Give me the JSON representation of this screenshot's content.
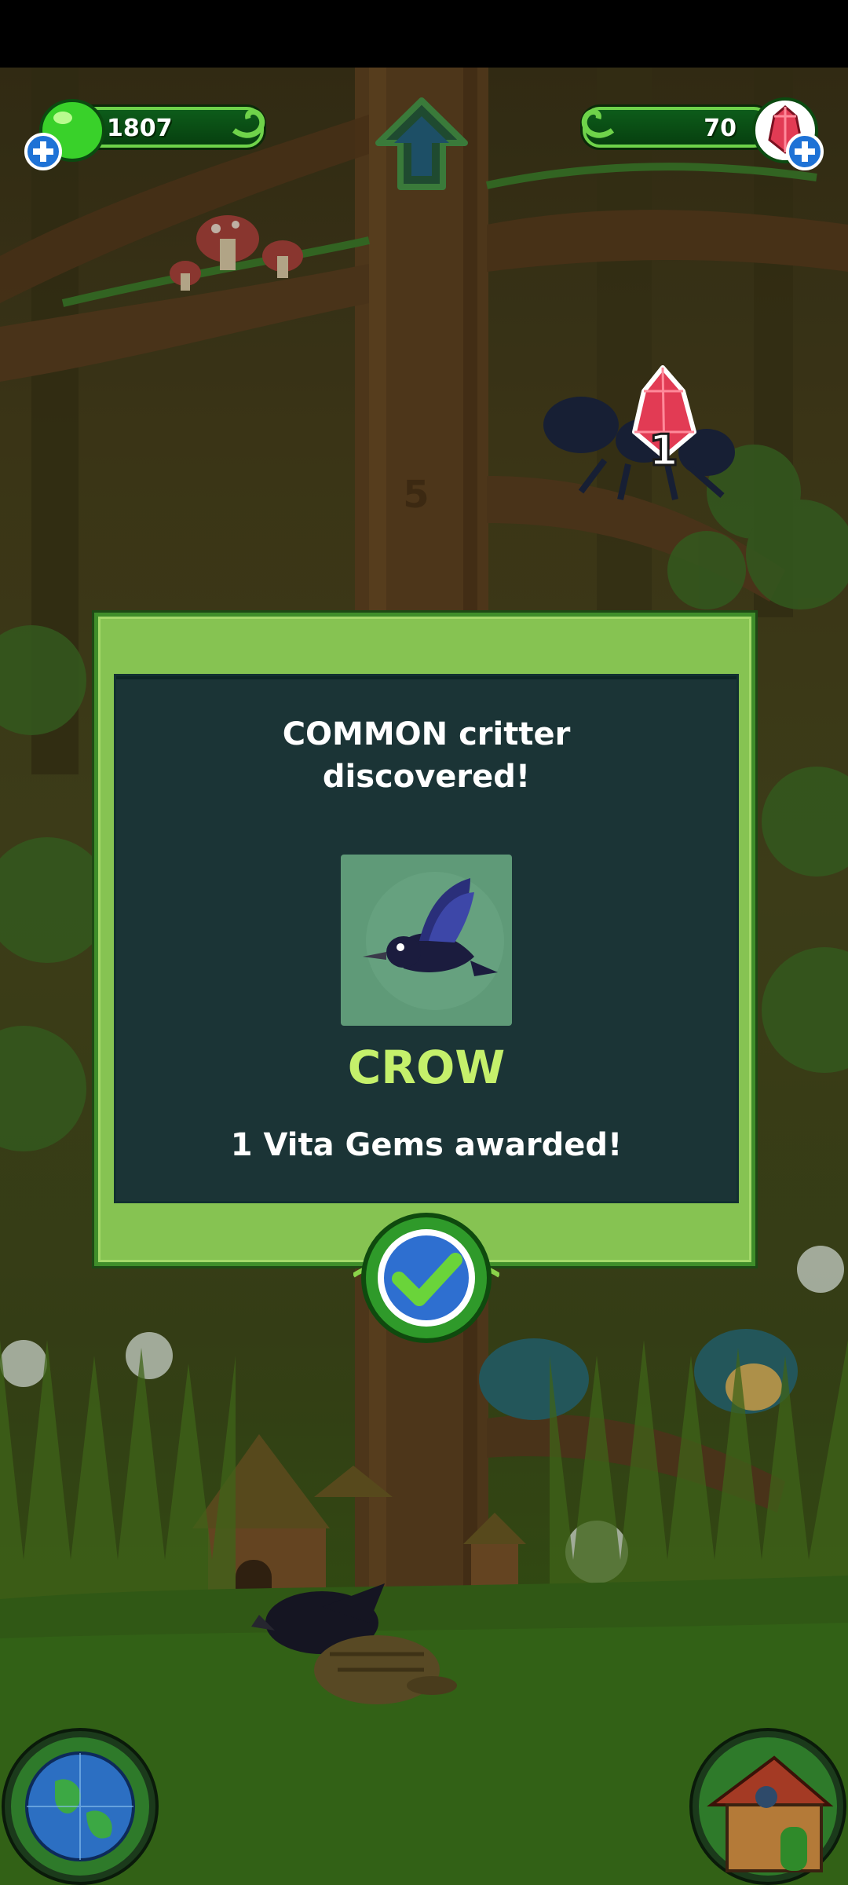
{
  "hud": {
    "vita_drops": {
      "value": "1807",
      "icon": "green-drop-icon",
      "add_icon": "plus-icon"
    },
    "vita_gems": {
      "value": "70",
      "icon": "red-gem-icon",
      "add_icon": "plus-icon"
    },
    "up_arrow_icon": "up-arrow-icon"
  },
  "scene": {
    "floating_gem": {
      "icon": "red-gem-icon",
      "count": "1"
    },
    "tree_level_number": "5"
  },
  "dialog": {
    "title": "COMMON critter\ndiscovered!",
    "critter_icon": "crow-icon",
    "critter_name": "CROW",
    "award_text": "1 Vita Gems awarded!",
    "confirm_icon": "checkmark-icon"
  },
  "bottom_nav": {
    "left_icon": "globe-icon",
    "right_icon": "house-icon"
  },
  "colors": {
    "dialog_green": "#86c352",
    "panel_dark": "#1b3436",
    "critter_name": "#c5f06b",
    "gem_red": "#e23b54",
    "drop_green": "#39d12a"
  }
}
